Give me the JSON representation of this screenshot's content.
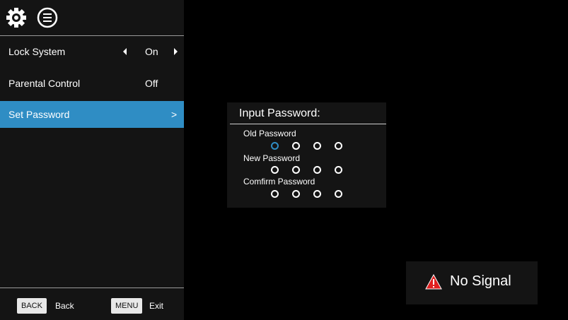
{
  "menu": {
    "items": [
      {
        "label": "Lock System",
        "value": "On"
      },
      {
        "label": "Parental Control",
        "value": "Off"
      },
      {
        "label": "Set Password",
        "chevron": ">"
      }
    ]
  },
  "footer": {
    "back_key": "BACK",
    "back_label": "Back",
    "menu_key": "MENU",
    "exit_label": "Exit"
  },
  "password_dialog": {
    "title": "Input Password:",
    "old_label": "Old Password",
    "new_label": "New Password",
    "confirm_label": "Comfirm Password",
    "digits_per_field": 4,
    "active_field": "old",
    "active_digit": 0
  },
  "status": {
    "no_signal": "No Signal"
  },
  "colors": {
    "accent": "#2f8dc4",
    "panel": "#141414",
    "warning": "#e02020"
  },
  "icons": {
    "settings": "gear-icon",
    "menu": "list-icon",
    "warning": "warning-icon"
  }
}
